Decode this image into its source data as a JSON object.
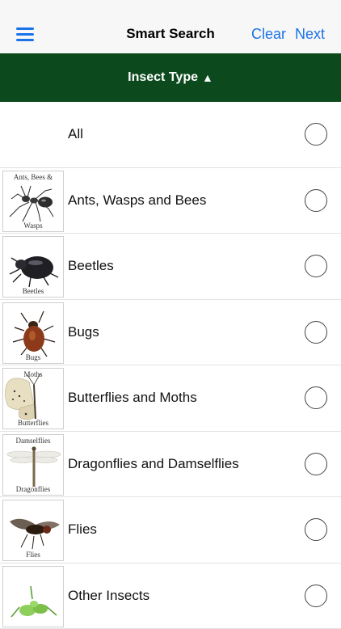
{
  "nav": {
    "title": "Smart Search",
    "clear_label": "Clear",
    "next_label": "Next",
    "menu_icon": "hamburger-menu-icon"
  },
  "section": {
    "title": "Insect Type",
    "sort_arrow": "▲"
  },
  "colors": {
    "accent": "#1a73e8",
    "header_bg": "#0c4a1d"
  },
  "items": [
    {
      "label": "All",
      "selected": false
    },
    {
      "label": "Ants, Wasps and Bees",
      "thumb_top": "Ants, Bees &",
      "thumb_bottom": "Wasps",
      "selected": false
    },
    {
      "label": "Beetles",
      "thumb_top": "",
      "thumb_bottom": "Beetles",
      "selected": false
    },
    {
      "label": "Bugs",
      "thumb_top": "",
      "thumb_bottom": "Bugs",
      "selected": false
    },
    {
      "label": "Butterflies and Moths",
      "thumb_top": "Moths",
      "thumb_bottom": "Butterflies",
      "selected": false
    },
    {
      "label": "Dragonflies and Damselflies",
      "thumb_top": "Damselflies",
      "thumb_bottom": "Dragonflies",
      "selected": false
    },
    {
      "label": "Flies",
      "thumb_top": "",
      "thumb_bottom": "Flies",
      "selected": false
    },
    {
      "label": "Other Insects",
      "thumb_top": "",
      "thumb_bottom": "",
      "selected": false
    }
  ]
}
